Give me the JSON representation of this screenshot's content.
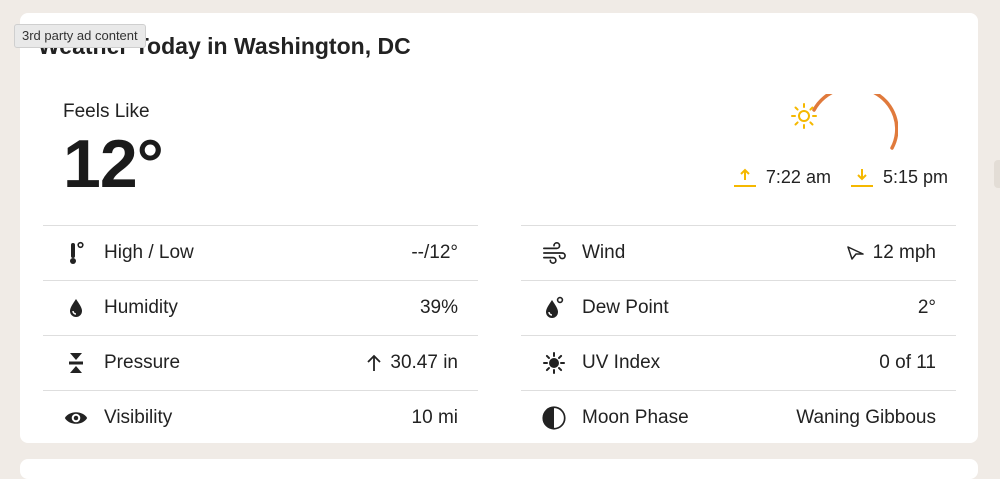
{
  "ad_tag": "3rd party ad content",
  "title": "Weather Today in Washington, DC",
  "feels_like": {
    "label": "Feels Like",
    "temp": "12°"
  },
  "sun": {
    "sunrise": "7:22 am",
    "sunset": "5:15 pm",
    "sunrise_icon": "sunrise-arrow-icon",
    "sunset_icon": "sunset-arrow-icon"
  },
  "left_rows": [
    {
      "label": "High / Low",
      "value": "--/12°",
      "icon": "thermometer-icon"
    },
    {
      "label": "Humidity",
      "value": "39%",
      "icon": "droplet-icon"
    },
    {
      "label": "Pressure",
      "value": "30.47 in",
      "icon": "pressure-icon"
    },
    {
      "label": "Visibility",
      "value": "10 mi",
      "icon": "eye-icon"
    }
  ],
  "right_rows": [
    {
      "label": "Wind",
      "value": "12 mph",
      "icon": "wind-icon"
    },
    {
      "label": "Dew Point",
      "value": "2°",
      "icon": "dew-point-icon"
    },
    {
      "label": "UV Index",
      "value": "0 of 11",
      "icon": "uv-sun-icon"
    },
    {
      "label": "Moon Phase",
      "value": "Waning Gibbous",
      "icon": "moon-phase-icon"
    }
  ],
  "colors": {
    "accent_orange": "#e07a3c",
    "sun_yellow": "#f5b800",
    "background": "#f0ebe6"
  }
}
